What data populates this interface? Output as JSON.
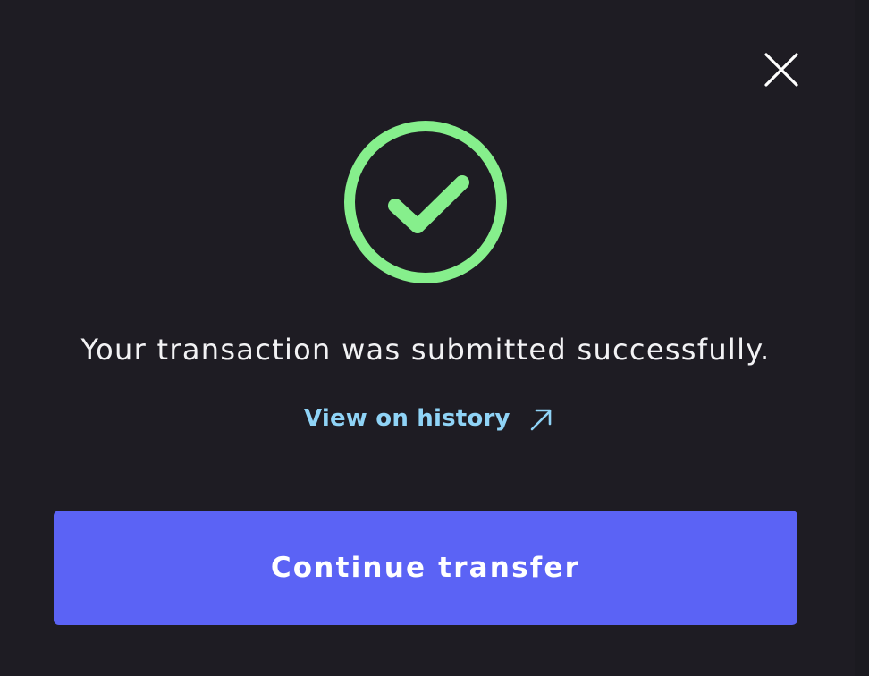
{
  "dialog": {
    "close_icon": "close-icon",
    "status_icon": "check-circle-icon",
    "message": "Your transaction was submitted successfully.",
    "history_link": {
      "label": "View on history",
      "icon": "arrow-up-right-icon"
    },
    "primary_button_label": "Continue transfer"
  },
  "colors": {
    "background": "#1e1c23",
    "success": "#86ef8c",
    "link": "#8fd3f6",
    "primary": "#5b63f5",
    "text": "#f2f2f4"
  }
}
